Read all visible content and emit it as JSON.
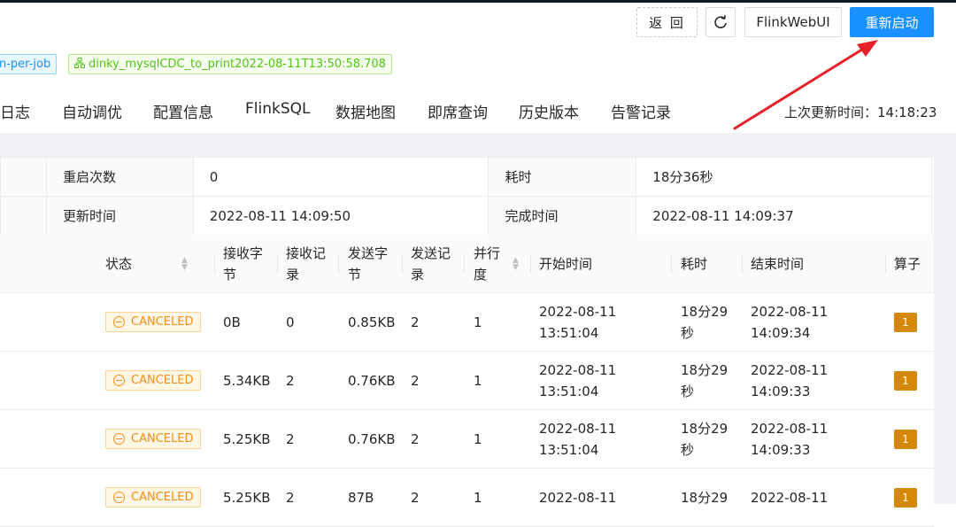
{
  "toolbar": {
    "back_label": "返 回",
    "refresh_icon": "refresh-icon",
    "flink_web_ui_label": "FlinkWebUI",
    "restart_label": "重新启动"
  },
  "tags": {
    "mode": "n-per-job",
    "job_name": "dinky_mysqlCDC_to_print2022-08-11T13:50:58.708",
    "job_icon": "cluster-icon"
  },
  "tabs": [
    "日志",
    "自动调优",
    "配置信息",
    "FlinkSQL",
    "数据地图",
    "即席查询",
    "历史版本",
    "告警记录"
  ],
  "last_update": "上次更新时间：14:18:23",
  "info": {
    "restart_count_label": "重启次数",
    "restart_count": "0",
    "duration_label": "耗时",
    "duration": "18分36秒",
    "update_time_label": "更新时间",
    "update_time": "2022-08-11 14:09:50",
    "finish_time_label": "完成时间",
    "finish_time": "2022-08-11 14:09:37"
  },
  "table": {
    "headers": {
      "status": "状态",
      "recv_bytes_1": "接收字",
      "recv_bytes_2": "节",
      "recv_records_1": "接收记",
      "recv_records_2": "录",
      "sent_bytes_1": "发送字",
      "sent_bytes_2": "节",
      "sent_records_1": "发送记",
      "sent_records_2": "录",
      "parallelism_1": "并行",
      "parallelism_2": "度",
      "start_time": "开始时间",
      "duration": "耗时",
      "end_time": "结束时间",
      "operator": "算子"
    },
    "rows": [
      {
        "status": "CANCELED",
        "recv_bytes": "0B",
        "recv_records": "0",
        "sent_bytes": "0.85KB",
        "sent_records": "2",
        "parallelism": "1",
        "start_1": "2022-08-11",
        "start_2": "13:51:04",
        "dur_1": "18分29",
        "dur_2": "秒",
        "end_1": "2022-08-11",
        "end_2": "14:09:34",
        "ops": "1"
      },
      {
        "status": "CANCELED",
        "recv_bytes": "5.34KB",
        "recv_records": "2",
        "sent_bytes": "0.76KB",
        "sent_records": "2",
        "parallelism": "1",
        "start_1": "2022-08-11",
        "start_2": "13:51:04",
        "dur_1": "18分29",
        "dur_2": "秒",
        "end_1": "2022-08-11",
        "end_2": "14:09:33",
        "ops": "1"
      },
      {
        "status": "CANCELED",
        "recv_bytes": "5.25KB",
        "recv_records": "2",
        "sent_bytes": "0.76KB",
        "sent_records": "2",
        "parallelism": "1",
        "start_1": "2022-08-11",
        "start_2": "13:51:04",
        "dur_1": "18分29",
        "dur_2": "秒",
        "end_1": "2022-08-11",
        "end_2": "14:09:33",
        "ops": "1"
      },
      {
        "status": "CANCELED",
        "recv_bytes": "5.25KB",
        "recv_records": "2",
        "sent_bytes": "87B",
        "sent_records": "2",
        "parallelism": "1",
        "start_1": "2022-08-11",
        "start_2": "",
        "dur_1": "18分29",
        "dur_2": "",
        "end_1": "2022-08-11",
        "end_2": "",
        "ops": "1"
      }
    ]
  },
  "colors": {
    "primary": "#1890ff",
    "canceled": "#fa8c16",
    "operator_badge": "#d48806",
    "annotation_arrow": "#e8202a"
  }
}
